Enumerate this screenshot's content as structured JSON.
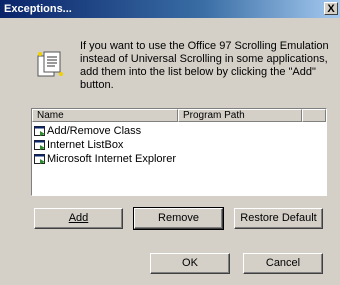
{
  "window": {
    "title": "Exceptions...",
    "close_glyph": "X"
  },
  "info": {
    "icon": "document-list-icon",
    "text": "If you want to use the Office 97 Scrolling Emulation instead of Universal Scrolling in some applications, add them into the list below by clicking the \"Add\" button."
  },
  "list": {
    "columns": [
      "Name",
      "Program Path"
    ],
    "rows": [
      {
        "name": "Add/Remove Class",
        "path": ""
      },
      {
        "name": "Internet ListBox",
        "path": ""
      },
      {
        "name": "Microsoft Internet Explorer",
        "path": ""
      }
    ],
    "row_icon": "window-icon"
  },
  "buttons": {
    "add": "Add",
    "remove": "Remove",
    "restore_default": "Restore Default",
    "ok": "OK",
    "cancel": "Cancel"
  }
}
